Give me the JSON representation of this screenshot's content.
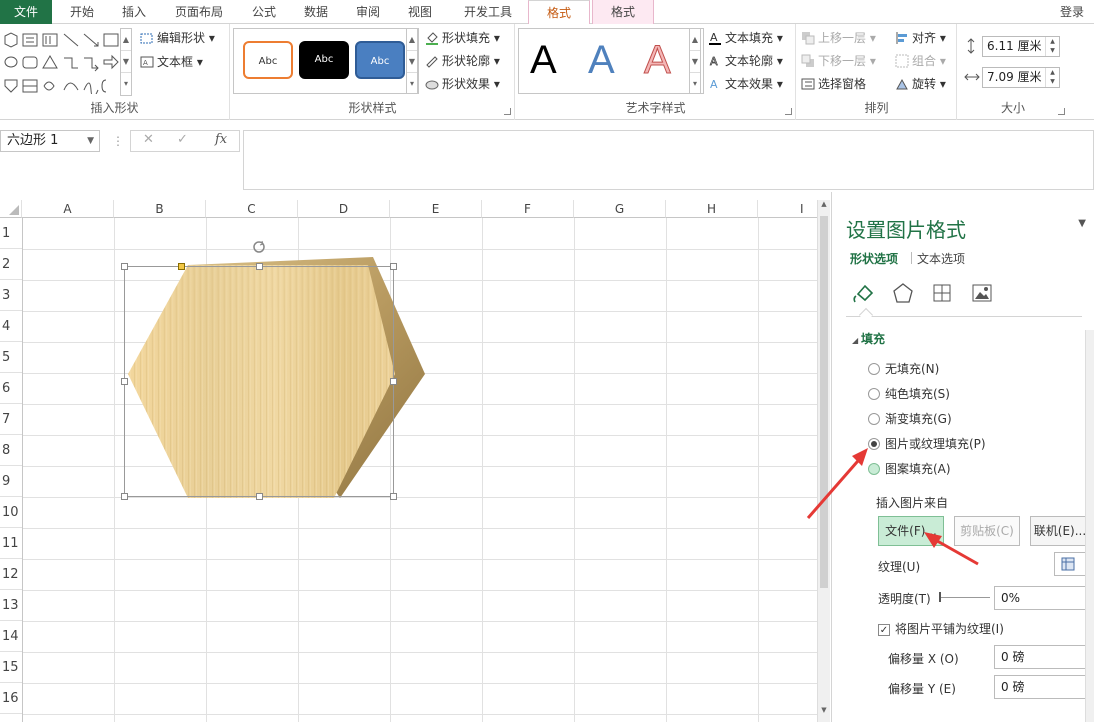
{
  "tabs": {
    "file": "文件",
    "home": "开始",
    "insert": "插入",
    "layout": "页面布局",
    "formulas": "公式",
    "data": "数据",
    "review": "审阅",
    "view": "视图",
    "developer": "开发工具",
    "format1": "格式",
    "format2": "格式",
    "login": "登录"
  },
  "ribbon": {
    "insert_shapes": {
      "label": "插入形状",
      "edit_shape": "编辑形状",
      "text_box": "文本框"
    },
    "shape_styles": {
      "label": "形状样式",
      "abc": "Abc",
      "fill": "形状填充",
      "outline": "形状轮廓",
      "effects": "形状效果"
    },
    "wordart": {
      "label": "艺术字样式",
      "glyph": "A",
      "text_fill": "文本填充",
      "text_outline": "文本轮廓",
      "text_effects": "文本效果"
    },
    "arrange": {
      "label": "排列",
      "bring_forward": "上移一层",
      "send_backward": "下移一层",
      "selection_pane": "选择窗格",
      "align": "对齐",
      "group": "组合",
      "rotate": "旋转"
    },
    "size": {
      "label": "大小",
      "height": "6.11 厘米",
      "width": "7.09 厘米"
    }
  },
  "formula_bar": {
    "name_box": "六边形 1",
    "cancel": "✕",
    "enter": "✓",
    "fx": "fx"
  },
  "sheet": {
    "columns": [
      "A",
      "B",
      "C",
      "D",
      "E",
      "F",
      "G",
      "H",
      "I"
    ],
    "rows": [
      "1",
      "2",
      "3",
      "4",
      "5",
      "6",
      "7",
      "8",
      "9",
      "10",
      "11",
      "12",
      "13",
      "14",
      "15",
      "16"
    ]
  },
  "pane": {
    "title": "设置图片格式",
    "tab_shape": "形状选项",
    "tab_text": "文本选项",
    "fill_section": "填充",
    "fill_options": [
      {
        "label": "无填充(N)",
        "checked": false
      },
      {
        "label": "纯色填充(S)",
        "checked": false
      },
      {
        "label": "渐变填充(G)",
        "checked": false
      },
      {
        "label": "图片或纹理填充(P)",
        "checked": true
      },
      {
        "label": "图案填充(A)",
        "checked": false
      }
    ],
    "insert_from": "插入图片来自",
    "file_btn": "文件(F)...",
    "clipboard_btn": "剪贴板(C)",
    "online_btn": "联机(E)...",
    "texture": "纹理(U)",
    "transparency": "透明度(T)",
    "transparency_value": "0%",
    "tile": "将图片平铺为纹理(I)",
    "offset_x": "偏移量 X (O)",
    "offset_x_value": "0 磅",
    "offset_y": "偏移量 Y (E)",
    "offset_y_value": "0 磅"
  },
  "colors": {
    "excel_green": "#217346",
    "arrow_red": "#e53935",
    "wood_light": "#e9cf94"
  }
}
